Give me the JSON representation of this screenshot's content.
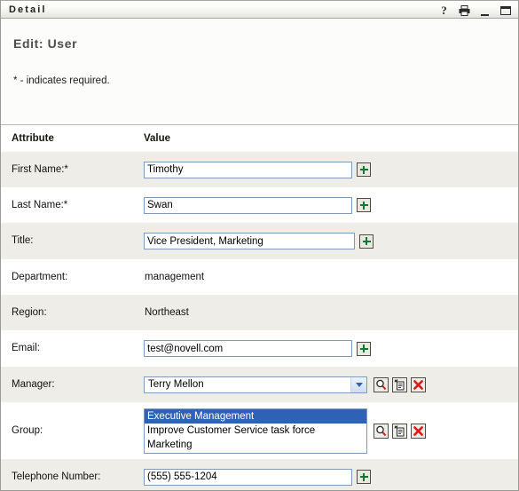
{
  "window": {
    "title": "Detail",
    "controls": [
      {
        "name": "help-icon",
        "glyph": "?",
        "label": "Help"
      },
      {
        "name": "print-icon",
        "glyph": "printer",
        "label": "Print"
      },
      {
        "name": "minimize-icon",
        "glyph": "_",
        "label": "Minimize"
      },
      {
        "name": "maximize-icon",
        "glyph": "square",
        "label": "Maximize"
      }
    ]
  },
  "header": {
    "title": "Edit: User",
    "required_note": "* - indicates required."
  },
  "table": {
    "columns": {
      "attribute": "Attribute",
      "value": "Value"
    }
  },
  "fields": {
    "first_name": {
      "label": "First Name:*",
      "value": "Timothy"
    },
    "last_name": {
      "label": "Last Name:*",
      "value": "Swan"
    },
    "title": {
      "label": "Title:",
      "value": "Vice President, Marketing"
    },
    "department": {
      "label": "Department:",
      "value": "management"
    },
    "region": {
      "label": "Region:",
      "value": "Northeast"
    },
    "email": {
      "label": "Email:",
      "value": "test@novell.com"
    },
    "manager": {
      "label": "Manager:",
      "value": "Terry Mellon",
      "options": [
        "Terry Mellon"
      ]
    },
    "group": {
      "label": "Group:",
      "items": [
        {
          "text": "Executive Management",
          "selected": true
        },
        {
          "text": "Improve Customer Service task force",
          "selected": false
        },
        {
          "text": "Marketing",
          "selected": false
        }
      ]
    },
    "telephone": {
      "label": "Telephone Number:",
      "value": "(555) 555-1204"
    }
  },
  "buttons": {
    "add_label": "+",
    "lookup_label": "Lookup",
    "history_label": "History",
    "clear_label": "Clear"
  },
  "colors": {
    "row_alt": "#eeede7",
    "titlebar_text": "#20201e",
    "accent_selection": "#2f62b5",
    "plus_green": "#0a7a2e",
    "clear_red": "#e01b1b",
    "input_border": "#7c9bbd"
  }
}
